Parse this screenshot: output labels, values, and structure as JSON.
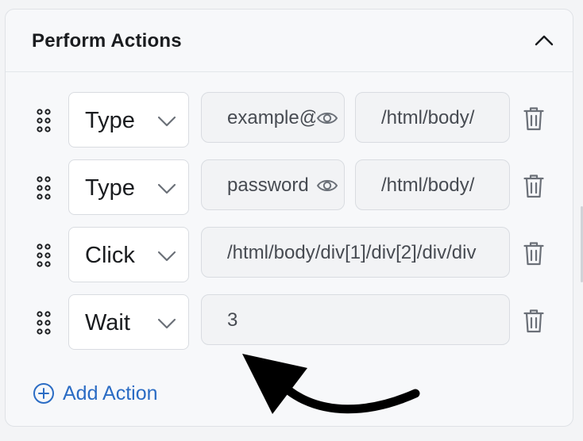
{
  "panel": {
    "title": "Perform Actions",
    "collapse_icon": "chevron-up-icon"
  },
  "actions": [
    {
      "type": "Type",
      "value": "example@",
      "xpath": "/html/body/",
      "has_eye": true
    },
    {
      "type": "Type",
      "value": "password",
      "xpath": "/html/body/",
      "has_eye": true
    },
    {
      "type": "Click",
      "value": "/html/body/div[1]/div[2]/div/div",
      "has_eye": false
    },
    {
      "type": "Wait",
      "value": "3",
      "has_eye": false
    }
  ],
  "add_action": {
    "label": "Add Action",
    "icon": "plus-circle-icon"
  },
  "icons": {
    "drag": "drag-handle-icon",
    "dropdown": "chevron-down-icon",
    "visibility": "eye-icon",
    "delete": "trash-icon"
  },
  "colors": {
    "accent": "#2b6cc4",
    "text": "#1a1c1f",
    "muted_icon": "#6b7078",
    "field_bg": "#f2f3f5",
    "arrow": "#000000"
  }
}
